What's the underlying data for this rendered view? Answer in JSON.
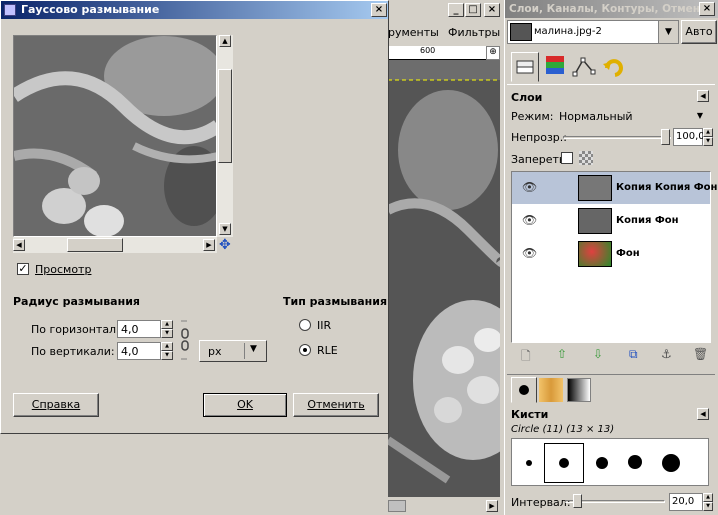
{
  "dialog": {
    "title": "Гауссово размывание",
    "preview_label": "Просмотр",
    "blur_radius_heading": "Радиус размывания",
    "horizontal_label": "По горизонтали:",
    "vertical_label": "По вертикали:",
    "horizontal_value": "4,0",
    "vertical_value": "4,0",
    "unit": "px",
    "blur_type_heading": "Тип размывания",
    "type_iir": "IIR",
    "type_rle": "RLE",
    "selected_type": "RLE",
    "help_button": "Справка",
    "ok_button": "OK",
    "cancel_button": "Отменить"
  },
  "image_window": {
    "menu_tools": "рументы",
    "menu_filters": "Фильтры",
    "ruler_mark": "600"
  },
  "layers_panel": {
    "title": "Слои, Каналы, Контуры, Отмен...",
    "image_name": "малина.jpg-2",
    "auto_button": "Авто",
    "section_title": "Слои",
    "mode_label": "Режим:",
    "mode_value": "Нормальный",
    "opacity_label": "Непрозр.:",
    "opacity_value": "100,0",
    "opacity_fraction": 1.0,
    "lock_label": "Запереть:",
    "layers": [
      {
        "name": "Копия Копия Фон",
        "selected": true
      },
      {
        "name": "Копия Фон",
        "selected": false
      },
      {
        "name": "Фон",
        "selected": false
      }
    ]
  },
  "brushes_panel": {
    "title": "Кисти",
    "brush_name": "Circle (11) (13 × 13)",
    "interval_label": "Интервал:",
    "interval_value": "20,0"
  },
  "icons": [
    "layers-icon",
    "channels-icon",
    "paths-icon",
    "undo-icon",
    "eye-icon",
    "chain-icon",
    "new-layer-icon",
    "raise-layer-icon",
    "lower-layer-icon",
    "duplicate-layer-icon",
    "anchor-icon",
    "delete-icon"
  ]
}
